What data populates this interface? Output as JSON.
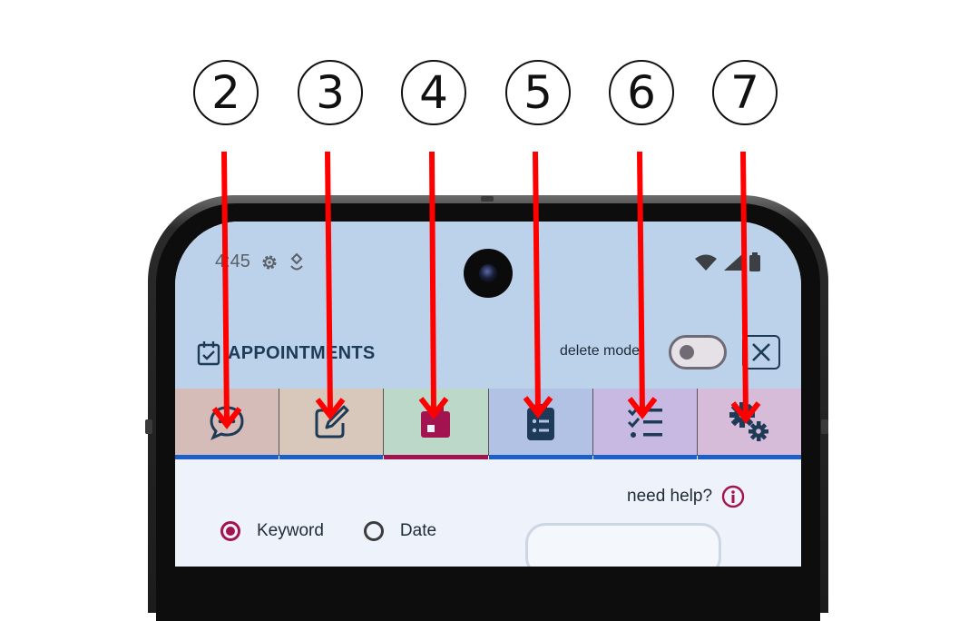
{
  "callouts": [
    "2",
    "3",
    "4",
    "5",
    "6",
    "7"
  ],
  "status_bar": {
    "time": "4:45"
  },
  "app": {
    "title": "APPOINTMENTS",
    "delete_mode_label": "delete mode",
    "delete_mode_on": false
  },
  "tabs": [
    {
      "icon": "chat-bubble-icon",
      "bg": "#d5bcb9",
      "active": false
    },
    {
      "icon": "edit-note-icon",
      "bg": "#d8c8bc",
      "active": false
    },
    {
      "icon": "calendar-day-icon",
      "bg": "#bcd8c8",
      "active": true
    },
    {
      "icon": "clipboard-list-icon",
      "bg": "#b2c2e4",
      "active": false
    },
    {
      "icon": "checklist-icon",
      "bg": "#c8b9e2",
      "active": false
    },
    {
      "icon": "gears-icon",
      "bg": "#d6bcd9",
      "active": false
    }
  ],
  "help": {
    "label": "need help?"
  },
  "search_mode": {
    "options": [
      "Keyword",
      "Date"
    ],
    "selected": "Keyword"
  },
  "colors": {
    "header": "#bcd2eb",
    "accent": "#a3134f",
    "tab_underline": "#1c5fc8",
    "title": "#1d3a57",
    "arrow": "#ff0000"
  }
}
